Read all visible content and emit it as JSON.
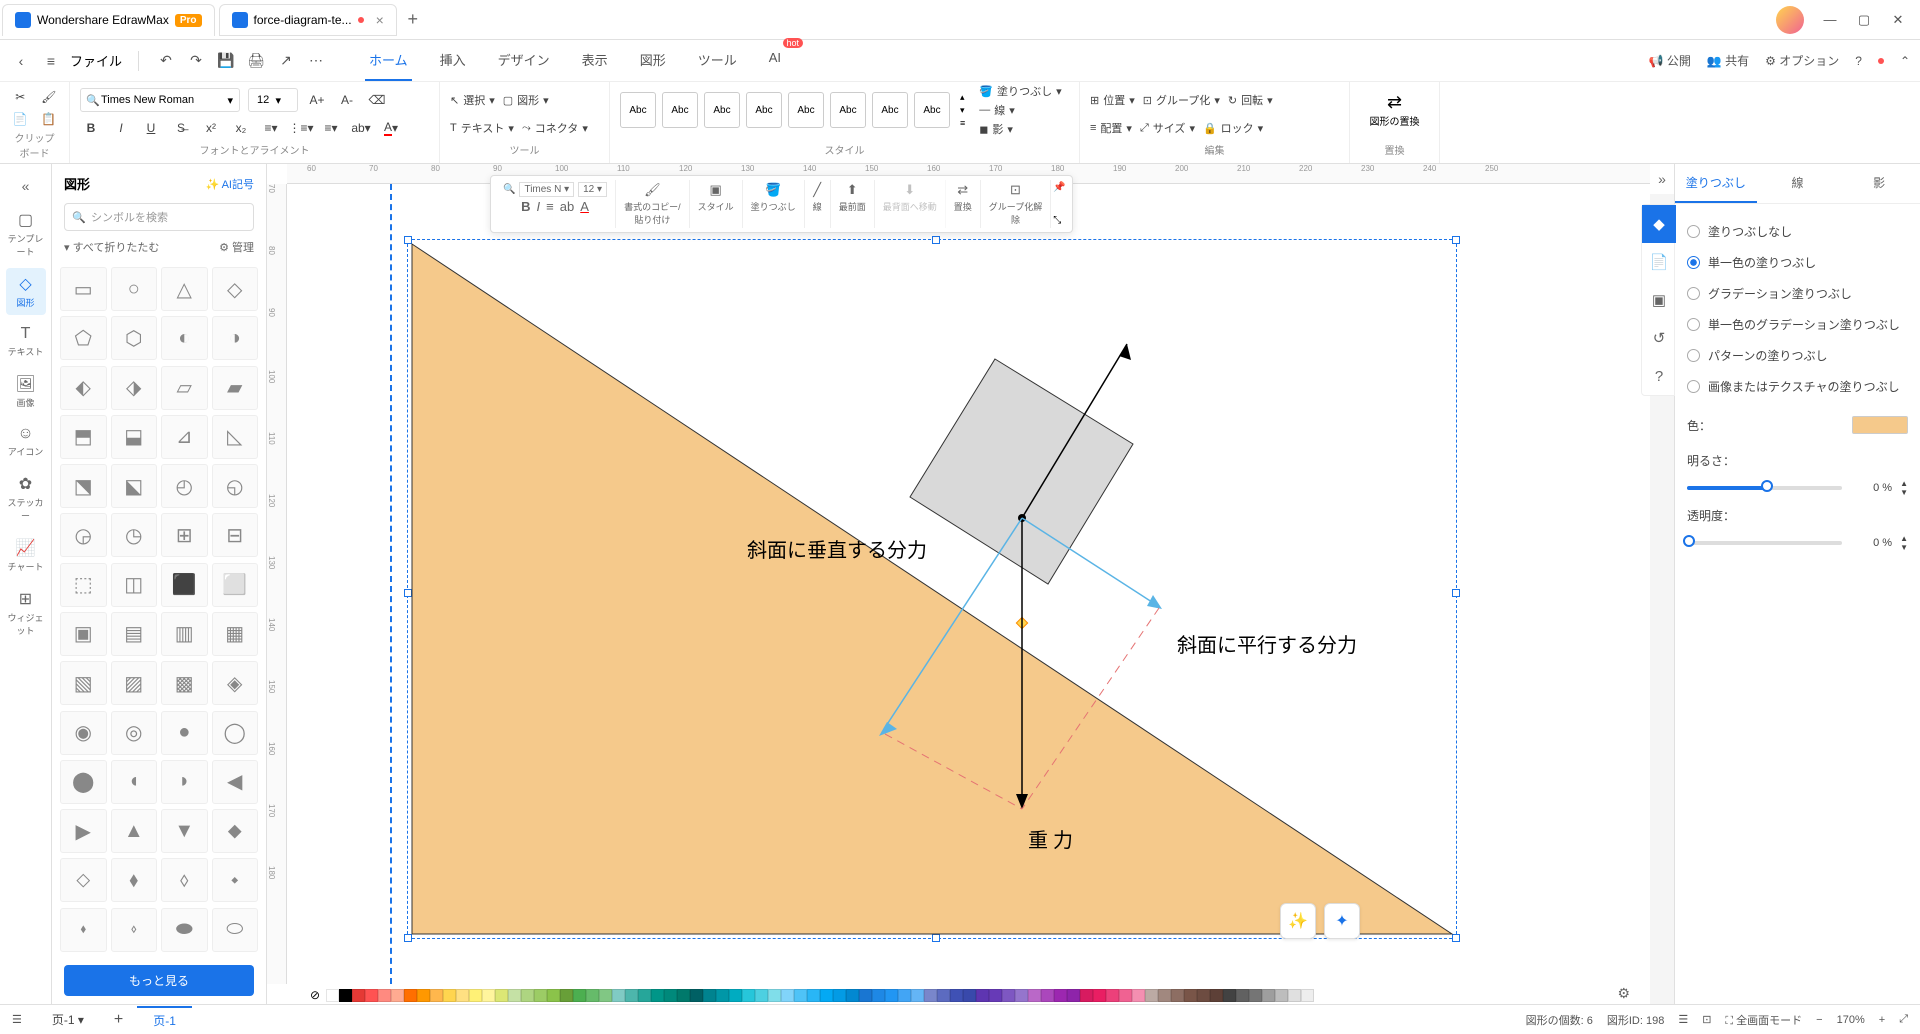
{
  "titlebar": {
    "app_name": "Wondershare EdrawMax",
    "pro": "Pro",
    "doc_tab": "force-diagram-te..."
  },
  "menubar": {
    "file": "ファイル",
    "tabs": [
      "ホーム",
      "挿入",
      "デザイン",
      "表示",
      "図形",
      "ツール",
      "AI"
    ],
    "active_tab": 0,
    "hot": "hot",
    "share": "公開",
    "collab": "共有",
    "options": "オプション"
  },
  "ribbon": {
    "font": "Times New Roman",
    "size": "12",
    "clipboard": "クリップボード",
    "font_align": "フォントとアライメント",
    "tool": "ツール",
    "select": "選択",
    "shape": "図形",
    "text": "テキスト",
    "connector": "コネクタ",
    "style": "スタイル",
    "style_label": "Abc",
    "fill": "塗りつぶし",
    "line": "線",
    "shadow": "影",
    "position": "位置",
    "align": "配置",
    "group": "グループ化",
    "size_btn": "サイズ",
    "rotate": "回転",
    "lock": "ロック",
    "edit": "編集",
    "replace_shape": "図形の置換",
    "replace": "置換"
  },
  "left_toolbar": {
    "items": [
      {
        "label": "テンプレート",
        "icon": "▢"
      },
      {
        "label": "図形",
        "icon": "◇"
      },
      {
        "label": "テキスト",
        "icon": "T"
      },
      {
        "label": "画像",
        "icon": "🖼"
      },
      {
        "label": "アイコン",
        "icon": "☺"
      },
      {
        "label": "ステッカー",
        "icon": "✿"
      },
      {
        "label": "チャート",
        "icon": "📈"
      },
      {
        "label": "ウィジェット",
        "icon": "⊞"
      }
    ],
    "active": 1
  },
  "shapes_panel": {
    "title": "図形",
    "ai": "AI記号",
    "search_placeholder": "シンボルを検索",
    "collapse_all": "すべて折りたたむ",
    "manage": "管理",
    "more": "もっと見る"
  },
  "canvas": {
    "label_perpendicular": "斜面に垂直する分力",
    "label_parallel": "斜面に平行する分力",
    "label_gravity": "重 力",
    "ruler_h": [
      "60",
      "70",
      "80",
      "90",
      "100",
      "110",
      "120",
      "130",
      "140",
      "150",
      "160",
      "170",
      "180",
      "190",
      "200",
      "210",
      "220",
      "230",
      "240",
      "250"
    ],
    "ruler_v": [
      "70",
      "80",
      "90",
      "100",
      "110",
      "120",
      "130",
      "140",
      "150",
      "160",
      "170",
      "180"
    ]
  },
  "float_toolbar": {
    "font": "Times N",
    "size": "12",
    "copy_format": "書式のコピー/\n貼り付け",
    "style": "スタイル",
    "fill": "塗りつぶし",
    "line": "線",
    "front": "最前面",
    "back": "最背面へ移動",
    "replace": "置換",
    "ungroup": "グループ化解\n除"
  },
  "right_panel": {
    "tabs": [
      "塗りつぶし",
      "線",
      "影"
    ],
    "active": 0,
    "options": {
      "none": "塗りつぶしなし",
      "solid": "単一色の塗りつぶし",
      "gradient": "グラデーション塗りつぶし",
      "solid_gradient": "単一色のグラデーション塗りつぶし",
      "pattern": "パターンの塗りつぶし",
      "image": "画像またはテクスチャの塗りつぶし"
    },
    "color_label": "色：",
    "brightness_label": "明るさ：",
    "brightness_val": "0 %",
    "opacity_label": "透明度：",
    "opacity_val": "0 %"
  },
  "statusbar": {
    "page": "页-1",
    "shape_count_label": "図形の個数:",
    "shape_count": "6",
    "shape_id_label": "図形ID:",
    "shape_id": "198",
    "fullscreen": "全画面モード",
    "zoom": "170%"
  },
  "colors": [
    "#ffffff",
    "#000000",
    "#e53935",
    "#ff5252",
    "#ff8a80",
    "#ffab91",
    "#ff6f00",
    "#ff9800",
    "#ffb74d",
    "#ffd54f",
    "#ffe082",
    "#fff176",
    "#fff59d",
    "#dce775",
    "#c5e1a5",
    "#aed581",
    "#9ccc65",
    "#8bc34a",
    "#689f38",
    "#4caf50",
    "#66bb6a",
    "#81c784",
    "#80cbc4",
    "#4db6ac",
    "#26a69a",
    "#009688",
    "#00897b",
    "#00796b",
    "#006064",
    "#00838f",
    "#0097a7",
    "#00acc1",
    "#26c6da",
    "#4dd0e1",
    "#80deea",
    "#81d4fa",
    "#4fc3f7",
    "#29b6f6",
    "#03a9f4",
    "#039be5",
    "#0288d1",
    "#1976d2",
    "#1e88e5",
    "#2196f3",
    "#42a5f5",
    "#64b5f6",
    "#7986cb",
    "#5c6bc0",
    "#3f51b5",
    "#3949ab",
    "#5e35b1",
    "#673ab7",
    "#7e57c2",
    "#9575cd",
    "#ba68c8",
    "#ab47bc",
    "#9c27b0",
    "#8e24aa",
    "#d81b60",
    "#e91e63",
    "#ec407a",
    "#f06292",
    "#f48fb1",
    "#bcaaa4",
    "#a1887f",
    "#8d6e63",
    "#795548",
    "#6d4c41",
    "#5d4037",
    "#424242",
    "#616161",
    "#757575",
    "#9e9e9e",
    "#bdbdbd",
    "#e0e0e0",
    "#eeeeee"
  ]
}
